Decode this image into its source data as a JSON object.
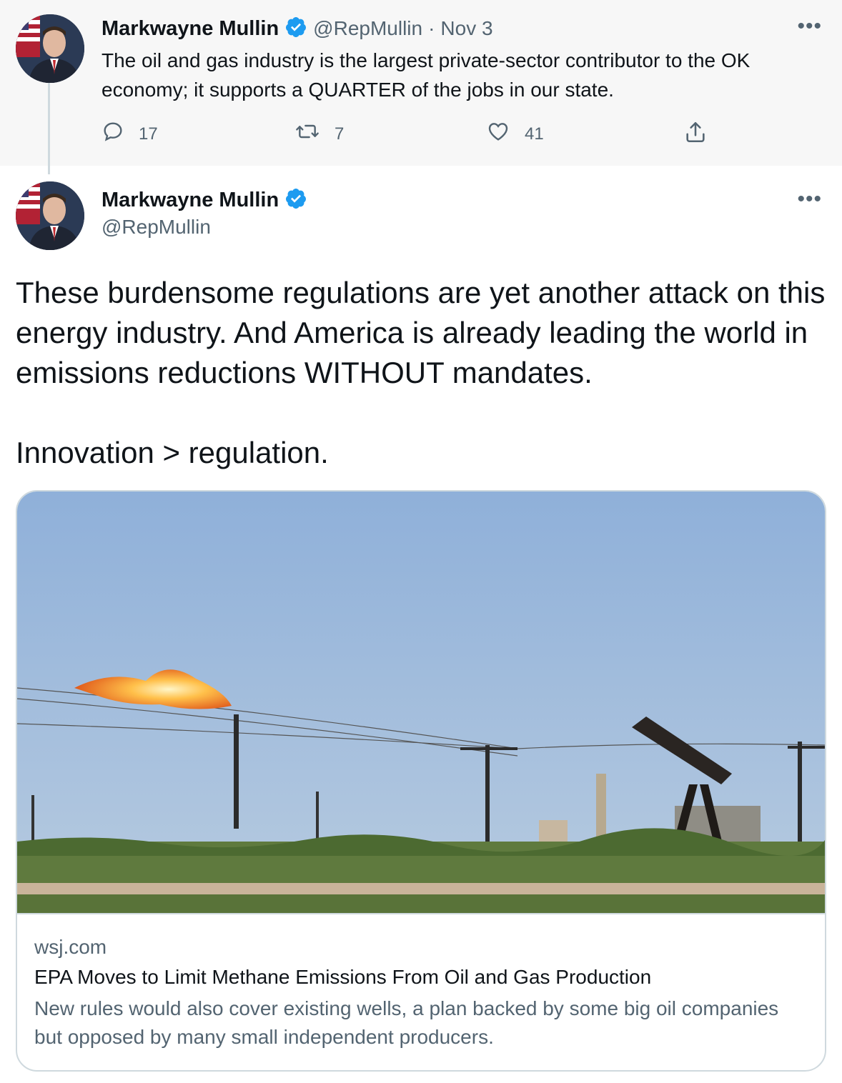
{
  "parent_tweet": {
    "author_name": "Markwayne Mullin",
    "handle": "@RepMullin",
    "separator": "·",
    "date": "Nov 3",
    "text": "The oil and gas industry is the largest private-sector contributor to the OK economy; it supports a QUARTER of the jobs in our state.",
    "actions": {
      "reply_count": "17",
      "retweet_count": "7",
      "like_count": "41"
    },
    "more_label": "•••"
  },
  "main_tweet": {
    "author_name": "Markwayne Mullin",
    "handle": "@RepMullin",
    "more_label": "•••",
    "text_paragraph_1": "These burdensome regulations are yet another attack on this energy industry. And America is already leading the world in emissions reductions WITHOUT mandates.",
    "text_paragraph_2": "Innovation > regulation.",
    "link_card": {
      "domain": "wsj.com",
      "title": "EPA Moves to Limit Methane Emissions From Oil and Gas Production",
      "description": "New rules would also cover existing wells, a plan backed by some big oil companies but opposed by many small independent producers."
    }
  },
  "colors": {
    "verified": "#1d9bf0",
    "muted": "#536471",
    "parent_bg": "#f7f7f7",
    "border": "#cfd9de"
  }
}
